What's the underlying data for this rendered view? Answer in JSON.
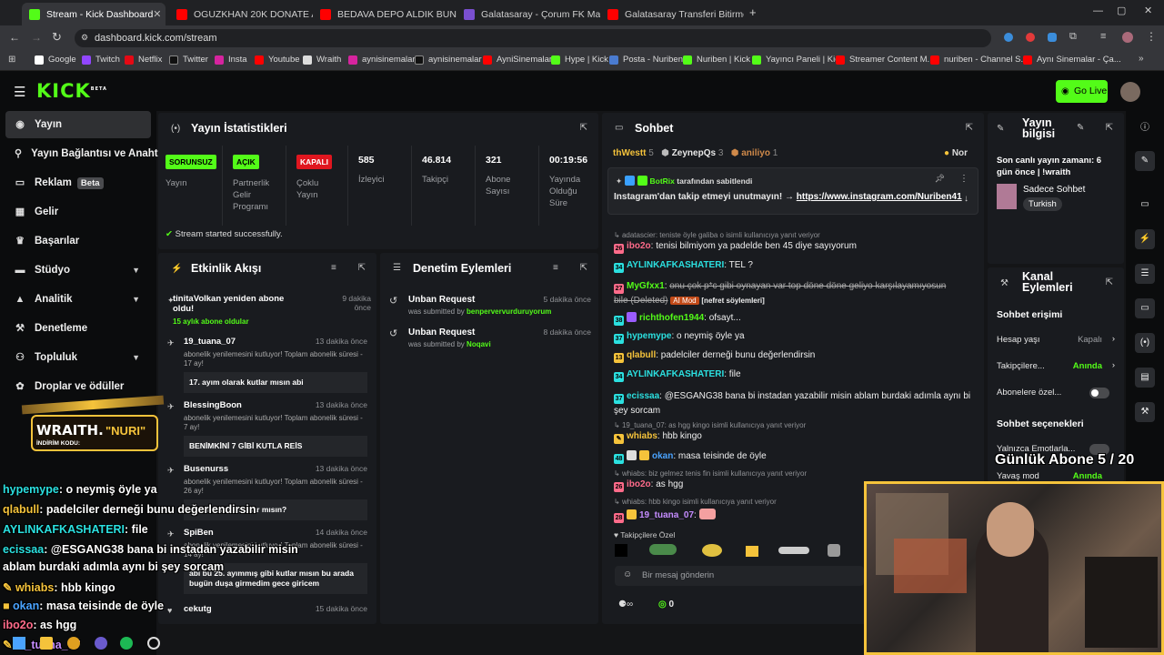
{
  "browser": {
    "tabs": [
      {
        "title": "Stream - Kick Dashboard",
        "active": true,
        "color": "#53fc18"
      },
      {
        "title": "OGUZKHAN 20K DONATE ALIY",
        "color": "#ff0000"
      },
      {
        "title": "BEDAVA DEPO ALDIK BUNLAR",
        "color": "#ff0000"
      },
      {
        "title": "Galatasaray - Çorum FK Maç Ö",
        "color": "#7a4fd0"
      },
      {
        "title": "Galatasaray Transferi Bitirmek i",
        "color": "#ff0000"
      }
    ],
    "url": "dashboard.kick.com/stream",
    "bookmarks": [
      "Google",
      "Twitch",
      "Netflix",
      "Twitter",
      "Insta",
      "Youtube",
      "Wraith",
      "aynisinemalar",
      "aynisinemalar",
      "AyniSinemalar",
      "Hype | Kick",
      "Posta - Nuriben",
      "Nuriben | Kick",
      "Yayıncı Paneli | Kick",
      "Streamer Content M...",
      "nuriben - Channel S...",
      "Aynı Sinemalar - Ça..."
    ]
  },
  "header": {
    "logo": "KICK",
    "logo_sup": "BETA",
    "go_live": "Go Live"
  },
  "sidebar": {
    "items": [
      {
        "label": "Yayın",
        "icon": "broadcast-icon",
        "active": true
      },
      {
        "label": "Yayın Bağlantısı ve Anahta",
        "icon": "link-icon"
      },
      {
        "label": "Reklam",
        "icon": "ad-icon",
        "badge": "Beta"
      },
      {
        "label": "Gelir",
        "icon": "dollar-icon"
      },
      {
        "label": "Başarılar",
        "icon": "trophy-icon"
      },
      {
        "label": "Stüdyo",
        "icon": "studio-icon",
        "chevron": true
      },
      {
        "label": "Analitik",
        "icon": "chart-icon",
        "chevron": true
      },
      {
        "label": "Denetleme",
        "icon": "gavel-icon"
      },
      {
        "label": "Topluluk",
        "icon": "community-icon",
        "chevron": true
      },
      {
        "label": "Droplar ve ödüller",
        "icon": "gift-icon"
      }
    ]
  },
  "stats": {
    "title": "Yayın İstatistikleri",
    "cols": [
      {
        "badge": "SORUNSUZ",
        "badge_color": "#53fc18",
        "label": "Yayın"
      },
      {
        "badge": "AÇIK",
        "badge_color": "#53fc18",
        "label": "Partnerlik Gelir Programı"
      },
      {
        "badge": "KAPALI",
        "badge_color": "#e0161f",
        "label": "Çoklu Yayın"
      },
      {
        "value": "585",
        "label": "İzleyici"
      },
      {
        "value": "46.814",
        "label": "Takipçi"
      },
      {
        "value": "321",
        "label": "Abone Sayısı"
      },
      {
        "value": "00:19:56",
        "label": "Yayında Olduğu Süre"
      }
    ],
    "success": "Stream started successfully."
  },
  "activity": {
    "title": "Etkinlik Akışı",
    "events": [
      {
        "name": "tinitaVolkan yeniden abone oldu!",
        "time": "9 dakika önce",
        "sub": "15 aylık abone oldular",
        "icon": "star"
      },
      {
        "name": "19_tuana_07",
        "time": "13 dakika önce",
        "desc": "abonelik yenilemesini kutluyor! Toplam abonelik süresi - 17 ay!",
        "msg": "17. ayım olarak kutlar mısın abi"
      },
      {
        "name": "BlessingBoon",
        "time": "13 dakika önce",
        "desc": "abonelik yenilemesini kutluyor! Toplam abonelik süresi - 7 ay!",
        "msg": "BENİMKİNİ 7 GİBİ KUTLA REİS"
      },
      {
        "name": "Busenurss",
        "time": "13 dakika önce",
        "desc": "abonelik yenilemesini kutluyor! Toplam abonelik süresi - 26 ay!",
        "msg": "benimkini de kutlar mısın?"
      },
      {
        "name": "SpiBen",
        "time": "14 dakika önce",
        "desc": "abonelik yenilemesini kutluyor! Toplam abonelik süresi - 14 ay!",
        "msg": "abi bu 25. ayımmış gibi kutlar mısın bu arada bugün duşa girmedim gece giricem"
      },
      {
        "name": "cekutg",
        "time": "15 dakika önce"
      }
    ]
  },
  "moderation": {
    "title": "Denetim Eylemleri",
    "actions": [
      {
        "name": "Unban Request",
        "time": "5 dakika önce",
        "by_label": "was submitted by",
        "by": "benpervervurduruyorum"
      },
      {
        "name": "Unban Request",
        "time": "8 dakika önce",
        "by_label": "was submitted by",
        "by": "Noqavi"
      }
    ]
  },
  "chat": {
    "title": "Sohbet",
    "top_users": [
      {
        "name": "thWestt",
        "count": "5"
      },
      {
        "name": "ZeynepQs",
        "count": "3"
      },
      {
        "name": "aniliyo",
        "count": "1"
      },
      {
        "name": "Nor",
        "count": ""
      }
    ],
    "pinned": {
      "by": "BotRix",
      "by_suffix": "tarafından sabitlendi",
      "text": "Instagram'dan takip etmeyi unutmayın! →",
      "link": "https://www.instagram.com/Nuriben41"
    },
    "messages": [
      {
        "type": "reply",
        "text": "adatascier: teniste öyle galiba o isimli kullanıcıya yanıt veriyor"
      },
      {
        "type": "msg",
        "badge": "26",
        "user": "ibo2o",
        "color": "#ff6b8a",
        "text": "tenisi bilmiyom ya padelde ben 45 diye sayıyorum"
      },
      {
        "type": "msg",
        "badge": "34",
        "user": "AYLINKAFKASHATERI",
        "color": "#2be0e0",
        "text": "TEL ?"
      },
      {
        "type": "msg",
        "badge": "27",
        "user": "MyGfxx1",
        "color": "#53fc18",
        "text": "onu çok p*c gibi oynayan var top döne döne geliyo karşılayamıyosun bile (Deleted)",
        "extra": "AI Mod",
        "extra2": "[nefret söylemleri]"
      },
      {
        "type": "msg",
        "badge": "38",
        "user": "richthofen1944",
        "color": "#53fc18",
        "text": "ofsayt..."
      },
      {
        "type": "msg",
        "badge": "37",
        "user": "hypemype",
        "color": "#2be0e0",
        "text": "o neymiş öyle ya"
      },
      {
        "type": "msg",
        "badge": "13",
        "user": "qlabull",
        "color": "#f5c33b",
        "text": "padelciler derneği bunu değerlendirsin"
      },
      {
        "type": "msg",
        "badge": "34",
        "user": "AYLINKAFKASHATERI",
        "color": "#2be0e0",
        "text": "file"
      },
      {
        "type": "msg",
        "badge": "37",
        "user": "ecissaa",
        "color": "#2be0e0",
        "text": "@ESGANG38 bana bi instadan yazabilir misin ablam burdaki adımla aynı bi şey sorcam"
      },
      {
        "type": "reply",
        "text": "19_tuana_07: as hgg kingo isimli kullanıcıya yanıt veriyor"
      },
      {
        "type": "msg",
        "badge": "",
        "user": "whiabs",
        "color": "#f5c33b",
        "text": "hbb kingo"
      },
      {
        "type": "msg",
        "badge": "48",
        "user": "okan",
        "color": "#4aa3ff",
        "text": "masa teisinde de öyle"
      },
      {
        "type": "reply",
        "text": "whiabs: biz gelmez tenis fin isimli kullanıcıya yanıt veriyor"
      },
      {
        "type": "msg",
        "badge": "26",
        "user": "ibo2o",
        "color": "#ff6b8a",
        "text": "as hgg"
      },
      {
        "type": "reply",
        "text": "whiabs: hbb kingo isimli kullanıcıya yanıt veriyor"
      },
      {
        "type": "msg",
        "badge": "28",
        "user": "19_tuana_07",
        "color": "#c58cff",
        "text": ""
      }
    ],
    "followers_only": "Takipçilere Özel",
    "input_placeholder": "Bir mesaj gönderin",
    "points": "0"
  },
  "stream_info": {
    "title": "Yayın bilgisi",
    "last_live": "Son canlı yayın zamanı: 6 gün önce | !wraith",
    "category": "Sadece Sohbet",
    "tag": "Turkish"
  },
  "channel_actions": {
    "title": "Kanal Eylemleri",
    "section1": "Sohbet erişimi",
    "rows": [
      {
        "label": "Hesap yaşı",
        "value": "Kapalı",
        "value_color": "#9ea0a4"
      },
      {
        "label": "Takipçilere...",
        "value": "Anında",
        "value_color": "#53fc18"
      },
      {
        "label": "Abonelere özel...",
        "toggle": true
      }
    ],
    "section2": "Sohbet seçenekleri",
    "rows2": [
      {
        "label": "Yalnızca Emotlarla..."
      },
      {
        "label": "Yavaş mod",
        "value": "Anında"
      }
    ]
  },
  "overlay": {
    "promo_brand": "WRAITH.",
    "promo_code_label": "İNDİRİM KODU:",
    "promo_code": "\"NURI\"",
    "goal": "Günlük Abone 5 / 20",
    "chat": [
      {
        "user": "hypemype",
        "color": "#2be0e0",
        "text": ": o neymiş öyle ya"
      },
      {
        "user": "qlabull",
        "color": "#f5c33b",
        "text": ": padelciler derneği bunu değerlendirsin"
      },
      {
        "user": "AYLINKAFKASHATERI",
        "color": "#2be0e0",
        "text": ": file"
      },
      {
        "user": "ecissaa",
        "color": "#2be0e0",
        "text": ": @ESGANG38 bana bi instadan yazabilir misin"
      },
      {
        "user": "",
        "color": "#fff",
        "text": "ablam burdaki adımla aynı bi şey sorcam"
      },
      {
        "user": "whiabs",
        "color": "#f5c33b",
        "text": ": hbb kingo"
      },
      {
        "user": "okan",
        "color": "#4aa3ff",
        "text": ": masa teisinde de öyle"
      },
      {
        "user": "ibo2o",
        "color": "#ff6b8a",
        "text": ": as hgg"
      },
      {
        "user": "19_tuana_07",
        "color": "#c58cff",
        "text": ""
      }
    ]
  }
}
